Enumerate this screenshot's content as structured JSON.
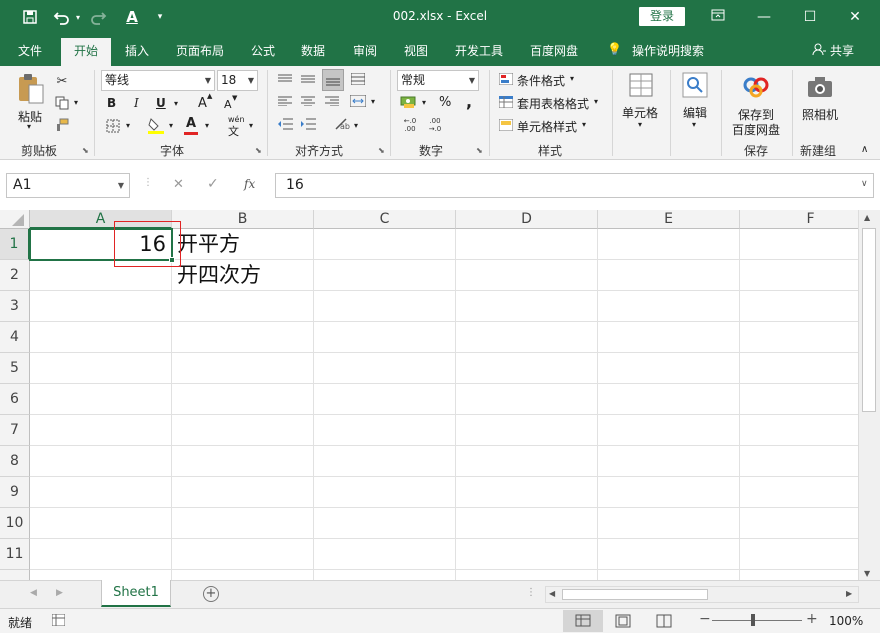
{
  "titlebar": {
    "title": "002.xlsx  -  Excel",
    "login_label": "登录",
    "save_icon": "save-icon",
    "undo_icon": "undo-icon",
    "redo_icon": "redo-icon",
    "font_color_icon": "font-color-icon",
    "customize_icon": "customize-icon",
    "restore_ribbon_icon": "ribbon-display-icon",
    "minimize": "—",
    "maximize": "☐",
    "close": "✕"
  },
  "tabs": {
    "file": "文件",
    "home": "开始",
    "insert": "插入",
    "page_layout": "页面布局",
    "formulas": "公式",
    "data": "数据",
    "review": "审阅",
    "view": "视图",
    "developer": "开发工具",
    "baidu": "百度网盘",
    "tell_me": "操作说明搜索",
    "share": "共享"
  },
  "ribbon": {
    "clipboard": {
      "label": "剪贴板",
      "paste": "粘贴"
    },
    "font": {
      "label": "字体",
      "font_name": "等线",
      "font_size": "18",
      "bold": "B",
      "italic": "I",
      "underline": "U",
      "grow": "A",
      "shrink": "A",
      "font_color": "A",
      "phonetic": "wén"
    },
    "alignment": {
      "label": "对齐方式"
    },
    "number": {
      "label": "数字",
      "format": "常规",
      "percent": "%",
      "comma": ",",
      "inc_decimal": ".0\n.00",
      "dec_decimal": ".00\n.0"
    },
    "styles": {
      "label": "样式",
      "conditional": "条件格式",
      "table": "套用表格格式",
      "cell_styles": "单元格样式"
    },
    "cells": {
      "label": "单元格"
    },
    "editing": {
      "label": "编辑"
    },
    "save": {
      "label": "保存",
      "save_to": "保存到",
      "baidu": "百度网盘"
    },
    "new_group": {
      "label": "新建组",
      "camera": "照相机"
    }
  },
  "formula_bar": {
    "name_box": "A1",
    "cancel": "✕",
    "enter": "✓",
    "fx": "fx",
    "value": "16"
  },
  "grid": {
    "columns": [
      "A",
      "B",
      "C",
      "D",
      "E",
      "F"
    ],
    "rows": [
      "1",
      "2",
      "3",
      "4",
      "5",
      "6",
      "7",
      "8",
      "9",
      "10",
      "11"
    ],
    "cells": {
      "A1": "16",
      "B1": "开平方",
      "B2": "开四次方"
    },
    "selected": "A1"
  },
  "sheets": {
    "tabs": [
      "Sheet1"
    ],
    "add": "+"
  },
  "status": {
    "ready": "就绪",
    "zoom": "100%",
    "zoom_out": "−",
    "zoom_in": "+"
  },
  "colors": {
    "brand": "#217346",
    "ribbon_bg": "#f3f3f3",
    "highlight": "#e02424"
  }
}
